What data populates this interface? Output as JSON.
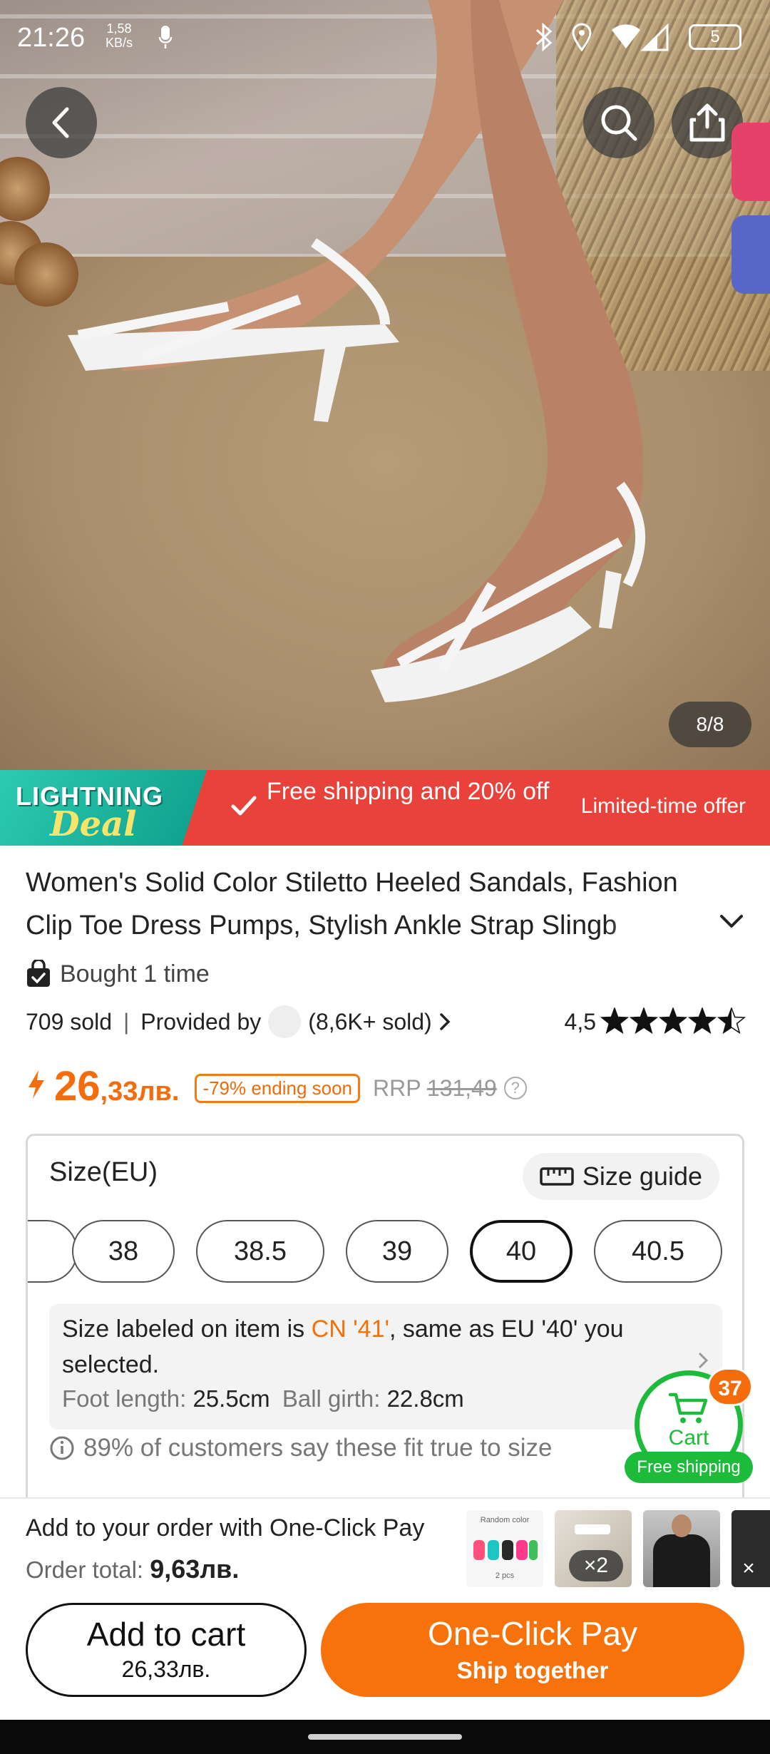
{
  "status_bar": {
    "time": "21:26",
    "net_speed_value": "1,58",
    "net_speed_unit": "KB/s",
    "network": "4G",
    "battery": "5"
  },
  "gallery": {
    "counter": "8/8"
  },
  "deal_banner": {
    "badge_line1": "LIGHTNING",
    "badge_line2": "Deal",
    "message": "Free shipping and 20% off",
    "limited": "Limited-time offer"
  },
  "product": {
    "title": "Women's Solid Color Stiletto Heeled Sandals, Fashion Clip Toe Dress Pumps, Stylish Ankle Strap Slingb",
    "bought": "Bought 1 time",
    "sold": "709 sold",
    "provided_by": "Provided by",
    "seller_sold": "(8,6K+ sold)",
    "rating": "4,5",
    "rating_value": 4.5,
    "rating_max": 5
  },
  "price": {
    "whole": "26",
    "fraction": ",33лв.",
    "discount": "-79% ending soon",
    "rrp_label": "RRP",
    "rrp_value": "131,49"
  },
  "size": {
    "title": "Size(EU)",
    "guide_label": "Size guide",
    "options": [
      "38",
      "38.5",
      "39",
      "40",
      "40.5"
    ],
    "selected": "40",
    "info_prefix": "Size labeled on item is ",
    "info_cn": "CN '41'",
    "info_suffix": ", same as EU '40' you selected.",
    "foot_label": "Foot length:",
    "foot_value": "25.5cm",
    "ball_label": "Ball girth:",
    "ball_value": "22.8cm",
    "fit_note": "89% of customers say these fit true to size"
  },
  "cart": {
    "label": "Cart",
    "count": "37",
    "free_shipping": "Free shipping"
  },
  "bottom": {
    "ocp_title": "Add to your order with One-Click Pay",
    "order_total_label": "Order total:",
    "order_total_value": "9,63лв.",
    "thumb1_label": "Random color",
    "thumb1_sub": "2 pcs",
    "thumb2_qty": "×2",
    "thumb4_close": "×",
    "add_to_cart": "Add to cart",
    "add_to_cart_price": "26,33лв.",
    "one_click": "One-Click Pay",
    "ship_together": "Ship together"
  },
  "colors": {
    "accent_orange": "#f8720c",
    "deal_red": "#e8423b",
    "deal_teal": "#1eb8a2",
    "cart_green": "#1dbb3a"
  },
  "icons": [
    "back-icon",
    "search-icon",
    "share-icon",
    "check-icon",
    "chevron-down-icon",
    "bag-icon",
    "chevron-right-icon",
    "star-icon",
    "lightning-icon",
    "help-icon",
    "ruler-icon",
    "info-icon",
    "cart-icon",
    "bluetooth-icon",
    "location-icon",
    "wifi-icon",
    "signal-icon",
    "mic-icon"
  ]
}
